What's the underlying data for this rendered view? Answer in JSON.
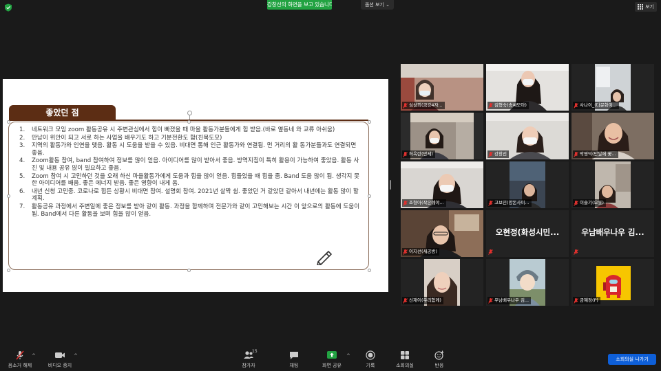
{
  "top": {
    "share_banner": "강창선의 화면을 보고 있습니다.",
    "options_label": "옵션 보기 ⌄",
    "view_label": "보기"
  },
  "slide": {
    "heading": "좋았던 점",
    "items": [
      {
        "num": "1.",
        "text": "네트워크 모임 zoom 활동공유 시 주변관심에서 힘이 빠졌을 때 마을 활동가분들에게 힘 받음.(바로 옆동네 와 교류 아쉬움)"
      },
      {
        "num": "2.",
        "text": "만남이 위안이 되고 서로 하는 사업을 배우기도 하고 기분전환도 함(친목도모)"
      },
      {
        "num": "3.",
        "text": "지역의 활동가와 인연을 맺음. 활동 시 도움을 받을 수 있음. 비대면 통해 인근 활동가와 연결됨. 먼 거리의 활 동가분들과도 연결되면 좋음."
      },
      {
        "num": "4.",
        "text": "Zoom활동 참여, band 참여하여 정보를 많이 얻음. 아이디어를 많이 받아서 좋음. 방역지침이 특히 활용이 가능하여 좋았음. 활동 사진 및 내용 공유 많이 필요하고 좋음."
      },
      {
        "num": "5.",
        "text": "Zoom 참여 시 고민하던 것을 오래 하신 마을활동가에게 도움과 힘을 많이 얻음. 힘들었을 때 힘을 줌. Band 도움 많이 됨. 생각지 못한 아이디어를 배움. 좋은 에너지 받음. 좋은 영향이 내게 옴."
      },
      {
        "num": "6.",
        "text": "내년 신청 고민중. 코로나로 힘든 상황시 비대면 참여. 설명회 참여. 2021년 살짝 쉼. 좋았던 거 같았던 같아서 내년에는 활동 많이 할 계획."
      },
      {
        "num": "7.",
        "text": "활동공유 과정에서 주변일에 좋은 정보를 받아 같이 활동. 과정을 함께하며 전문가와 같이 고민해보는 시간 이 앞으로의 활동에 도움이 됨. Band에서 다른 활동을 보며 힘을 많이 얻음."
      }
    ]
  },
  "participants": [
    {
      "name": "심상희(금강4자..."
    },
    {
      "name": "김형숙(송씨모아)"
    },
    {
      "name": "사나이_(다문화이..."
    },
    {
      "name": "허옥란(만세)"
    },
    {
      "name": "강창선"
    },
    {
      "name": "박영덕(반달에 꽃..."
    },
    {
      "name": "조형아(작은예야..."
    },
    {
      "name": "고보민(양돈사이..."
    },
    {
      "name": "이슬기(오롯)"
    },
    {
      "name": "이지선(새공방)"
    },
    {
      "name": "오현정(화성시민..."
    },
    {
      "name": "우남배우나우 김..."
    },
    {
      "name": "신재이(우리함께)"
    },
    {
      "name": "우남배우나우 김..."
    },
    {
      "name": "금혜정(P)"
    }
  ],
  "toolbar": {
    "mute": "음소거 해제",
    "video": "비디오 중지",
    "participants": "참가자",
    "participants_count": "15",
    "chat": "채팅",
    "share": "화면 공유",
    "record": "기록",
    "breakout": "소회의실",
    "reactions": "반응",
    "leave": "소회의실 나가기"
  },
  "colors": {
    "share_green": "#22a342",
    "leave_blue": "#0e5fd8",
    "slide_heading": "#5c2d14",
    "active_speaker": "#b5d33b",
    "mic_off_red": "#e0312e"
  }
}
